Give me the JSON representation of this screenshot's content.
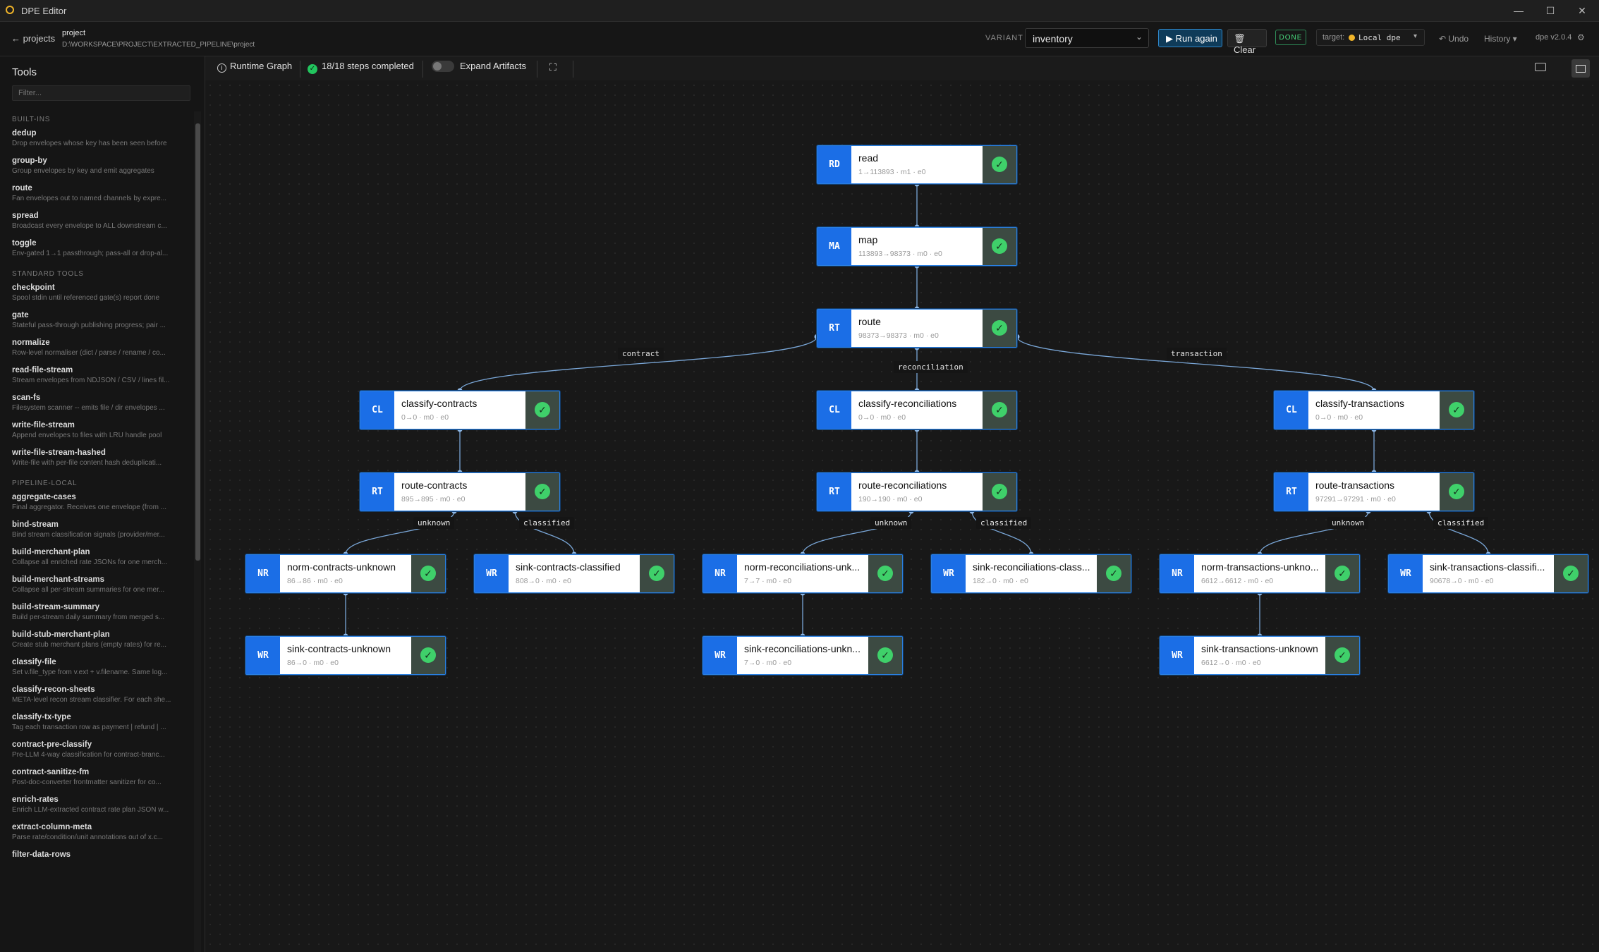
{
  "window": {
    "title": "DPE Editor"
  },
  "header": {
    "back_label": "← projects",
    "project_name": "project",
    "project_path": "D:\\WORKSPACE\\PROJECT\\EXTRACTED_PIPELINE\\project",
    "variant_label": "VARIANT",
    "variant_value": "inventory",
    "run_label": "▶ Run again",
    "clear_label": "🗑 Clear",
    "status_badge": "DONE",
    "target_label": "target:",
    "target_value": "Local dpe",
    "undo_label": "↶ Undo",
    "history_label": "History ▾",
    "version": "dpe v2.0.4",
    "colors": {
      "accent": "#2f86c8",
      "done": "#4ade80",
      "node_badge": "#1b6ee6",
      "status_ok": "#3fd06a"
    }
  },
  "sidebar": {
    "title": "Tools",
    "filter_placeholder": "Filter...",
    "sections": [
      {
        "title": "BUILT-INS",
        "tools": [
          {
            "name": "dedup",
            "desc": "Drop envelopes whose key has been seen before"
          },
          {
            "name": "group-by",
            "desc": "Group envelopes by key and emit aggregates"
          },
          {
            "name": "route",
            "desc": "Fan envelopes out to named channels by expre..."
          },
          {
            "name": "spread",
            "desc": "Broadcast every envelope to ALL downstream c..."
          },
          {
            "name": "toggle",
            "desc": "Env-gated 1→1 passthrough; pass-all or drop-al..."
          }
        ]
      },
      {
        "title": "STANDARD TOOLS",
        "tools": [
          {
            "name": "checkpoint",
            "desc": "Spool stdin until referenced gate(s) report done"
          },
          {
            "name": "gate",
            "desc": "Stateful pass-through publishing progress; pair ..."
          },
          {
            "name": "normalize",
            "desc": "Row-level normaliser (dict / parse / rename / co..."
          },
          {
            "name": "read-file-stream",
            "desc": "Stream envelopes from NDJSON / CSV / lines fil..."
          },
          {
            "name": "scan-fs",
            "desc": "Filesystem scanner -- emits file / dir envelopes ..."
          },
          {
            "name": "write-file-stream",
            "desc": "Append envelopes to files with LRU handle pool"
          },
          {
            "name": "write-file-stream-hashed",
            "desc": "Write-file with per-file content hash deduplicati..."
          }
        ]
      },
      {
        "title": "PIPELINE-LOCAL",
        "tools": [
          {
            "name": "aggregate-cases",
            "desc": "Final aggregator. Receives one envelope (from ..."
          },
          {
            "name": "bind-stream",
            "desc": "Bind stream classification signals (provider/mer..."
          },
          {
            "name": "build-merchant-plan",
            "desc": "Collapse all enriched rate JSONs for one merch..."
          },
          {
            "name": "build-merchant-streams",
            "desc": "Collapse all per-stream summaries for one mer..."
          },
          {
            "name": "build-stream-summary",
            "desc": "Build per-stream daily summary from merged s..."
          },
          {
            "name": "build-stub-merchant-plan",
            "desc": "Create stub merchant plans (empty rates) for re..."
          },
          {
            "name": "classify-file",
            "desc": "Set v.file_type from v.ext + v.filename. Same log..."
          },
          {
            "name": "classify-recon-sheets",
            "desc": "META-level recon stream classifier. For each she..."
          },
          {
            "name": "classify-tx-type",
            "desc": "Tag each transaction row as payment | refund | ..."
          },
          {
            "name": "contract-pre-classify",
            "desc": "Pre-LLM 4-way classification for contract-branc..."
          },
          {
            "name": "contract-sanitize-fm",
            "desc": "Post-doc-converter frontmatter sanitizer for co..."
          },
          {
            "name": "enrich-rates",
            "desc": "Enrich LLM-extracted contract rate plan JSON w..."
          },
          {
            "name": "extract-column-meta",
            "desc": "Parse rate/condition/unit annotations out of x.c..."
          },
          {
            "name": "filter-data-rows",
            "desc": ""
          }
        ]
      }
    ]
  },
  "canvas_toolbar": {
    "runtime_graph": "Runtime Graph",
    "steps_completed": "18/18 steps completed",
    "expand_artifacts": "Expand Artifacts"
  },
  "graph": {
    "nodes": [
      {
        "id": "read",
        "badge": "RD",
        "label": "read",
        "stats": "1→113893 · m1 · e0"
      },
      {
        "id": "map",
        "badge": "MA",
        "label": "map",
        "stats": "113893→98373 · m0 · e0"
      },
      {
        "id": "route",
        "badge": "RT",
        "label": "route",
        "stats": "98373→98373 · m0 · e0"
      },
      {
        "id": "cc",
        "badge": "CL",
        "label": "classify-contracts",
        "stats": "0→0 · m0 · e0"
      },
      {
        "id": "cr",
        "badge": "CL",
        "label": "classify-reconciliations",
        "stats": "0→0 · m0 · e0"
      },
      {
        "id": "ct",
        "badge": "CL",
        "label": "classify-transactions",
        "stats": "0→0 · m0 · e0"
      },
      {
        "id": "rc",
        "badge": "RT",
        "label": "route-contracts",
        "stats": "895→895 · m0 · e0"
      },
      {
        "id": "rr",
        "badge": "RT",
        "label": "route-reconciliations",
        "stats": "190→190 · m0 · e0"
      },
      {
        "id": "rt",
        "badge": "RT",
        "label": "route-transactions",
        "stats": "97291→97291 · m0 · e0"
      },
      {
        "id": "ncu",
        "badge": "NR",
        "label": "norm-contracts-unknown",
        "stats": "86→86 · m0 · e0"
      },
      {
        "id": "scc",
        "badge": "WR",
        "label": "sink-contracts-classified",
        "stats": "808→0 · m0 · e0"
      },
      {
        "id": "nru",
        "badge": "NR",
        "label": "norm-reconciliations-unk...",
        "stats": "7→7 · m0 · e0"
      },
      {
        "id": "src",
        "badge": "WR",
        "label": "sink-reconciliations-class...",
        "stats": "182→0 · m0 · e0"
      },
      {
        "id": "ntu",
        "badge": "NR",
        "label": "norm-transactions-unkno...",
        "stats": "6612→6612 · m0 · e0"
      },
      {
        "id": "stc",
        "badge": "WR",
        "label": "sink-transactions-classifi...",
        "stats": "90678→0 · m0 · e0"
      },
      {
        "id": "scu",
        "badge": "WR",
        "label": "sink-contracts-unknown",
        "stats": "86→0 · m0 · e0"
      },
      {
        "id": "sru",
        "badge": "WR",
        "label": "sink-reconciliations-unkn...",
        "stats": "7→0 · m0 · e0"
      },
      {
        "id": "stu",
        "badge": "WR",
        "label": "sink-transactions-unknown",
        "stats": "6612→0 · m0 · e0"
      }
    ],
    "edges": [
      {
        "from": "read",
        "to": "map",
        "label": ""
      },
      {
        "from": "map",
        "to": "route",
        "label": ""
      },
      {
        "from": "route",
        "to": "cc",
        "label": "contract"
      },
      {
        "from": "route",
        "to": "cr",
        "label": "reconciliation"
      },
      {
        "from": "route",
        "to": "ct",
        "label": "transaction"
      },
      {
        "from": "cc",
        "to": "rc",
        "label": ""
      },
      {
        "from": "cr",
        "to": "rr",
        "label": ""
      },
      {
        "from": "ct",
        "to": "rt",
        "label": ""
      },
      {
        "from": "rc",
        "to": "ncu",
        "label": "unknown"
      },
      {
        "from": "rc",
        "to": "scc",
        "label": "classified"
      },
      {
        "from": "rr",
        "to": "nru",
        "label": "unknown"
      },
      {
        "from": "rr",
        "to": "src",
        "label": "classified"
      },
      {
        "from": "rt",
        "to": "ntu",
        "label": "unknown"
      },
      {
        "from": "rt",
        "to": "stc",
        "label": "classified"
      },
      {
        "from": "ncu",
        "to": "scu",
        "label": ""
      },
      {
        "from": "nru",
        "to": "sru",
        "label": ""
      },
      {
        "from": "ntu",
        "to": "stu",
        "label": ""
      }
    ]
  }
}
